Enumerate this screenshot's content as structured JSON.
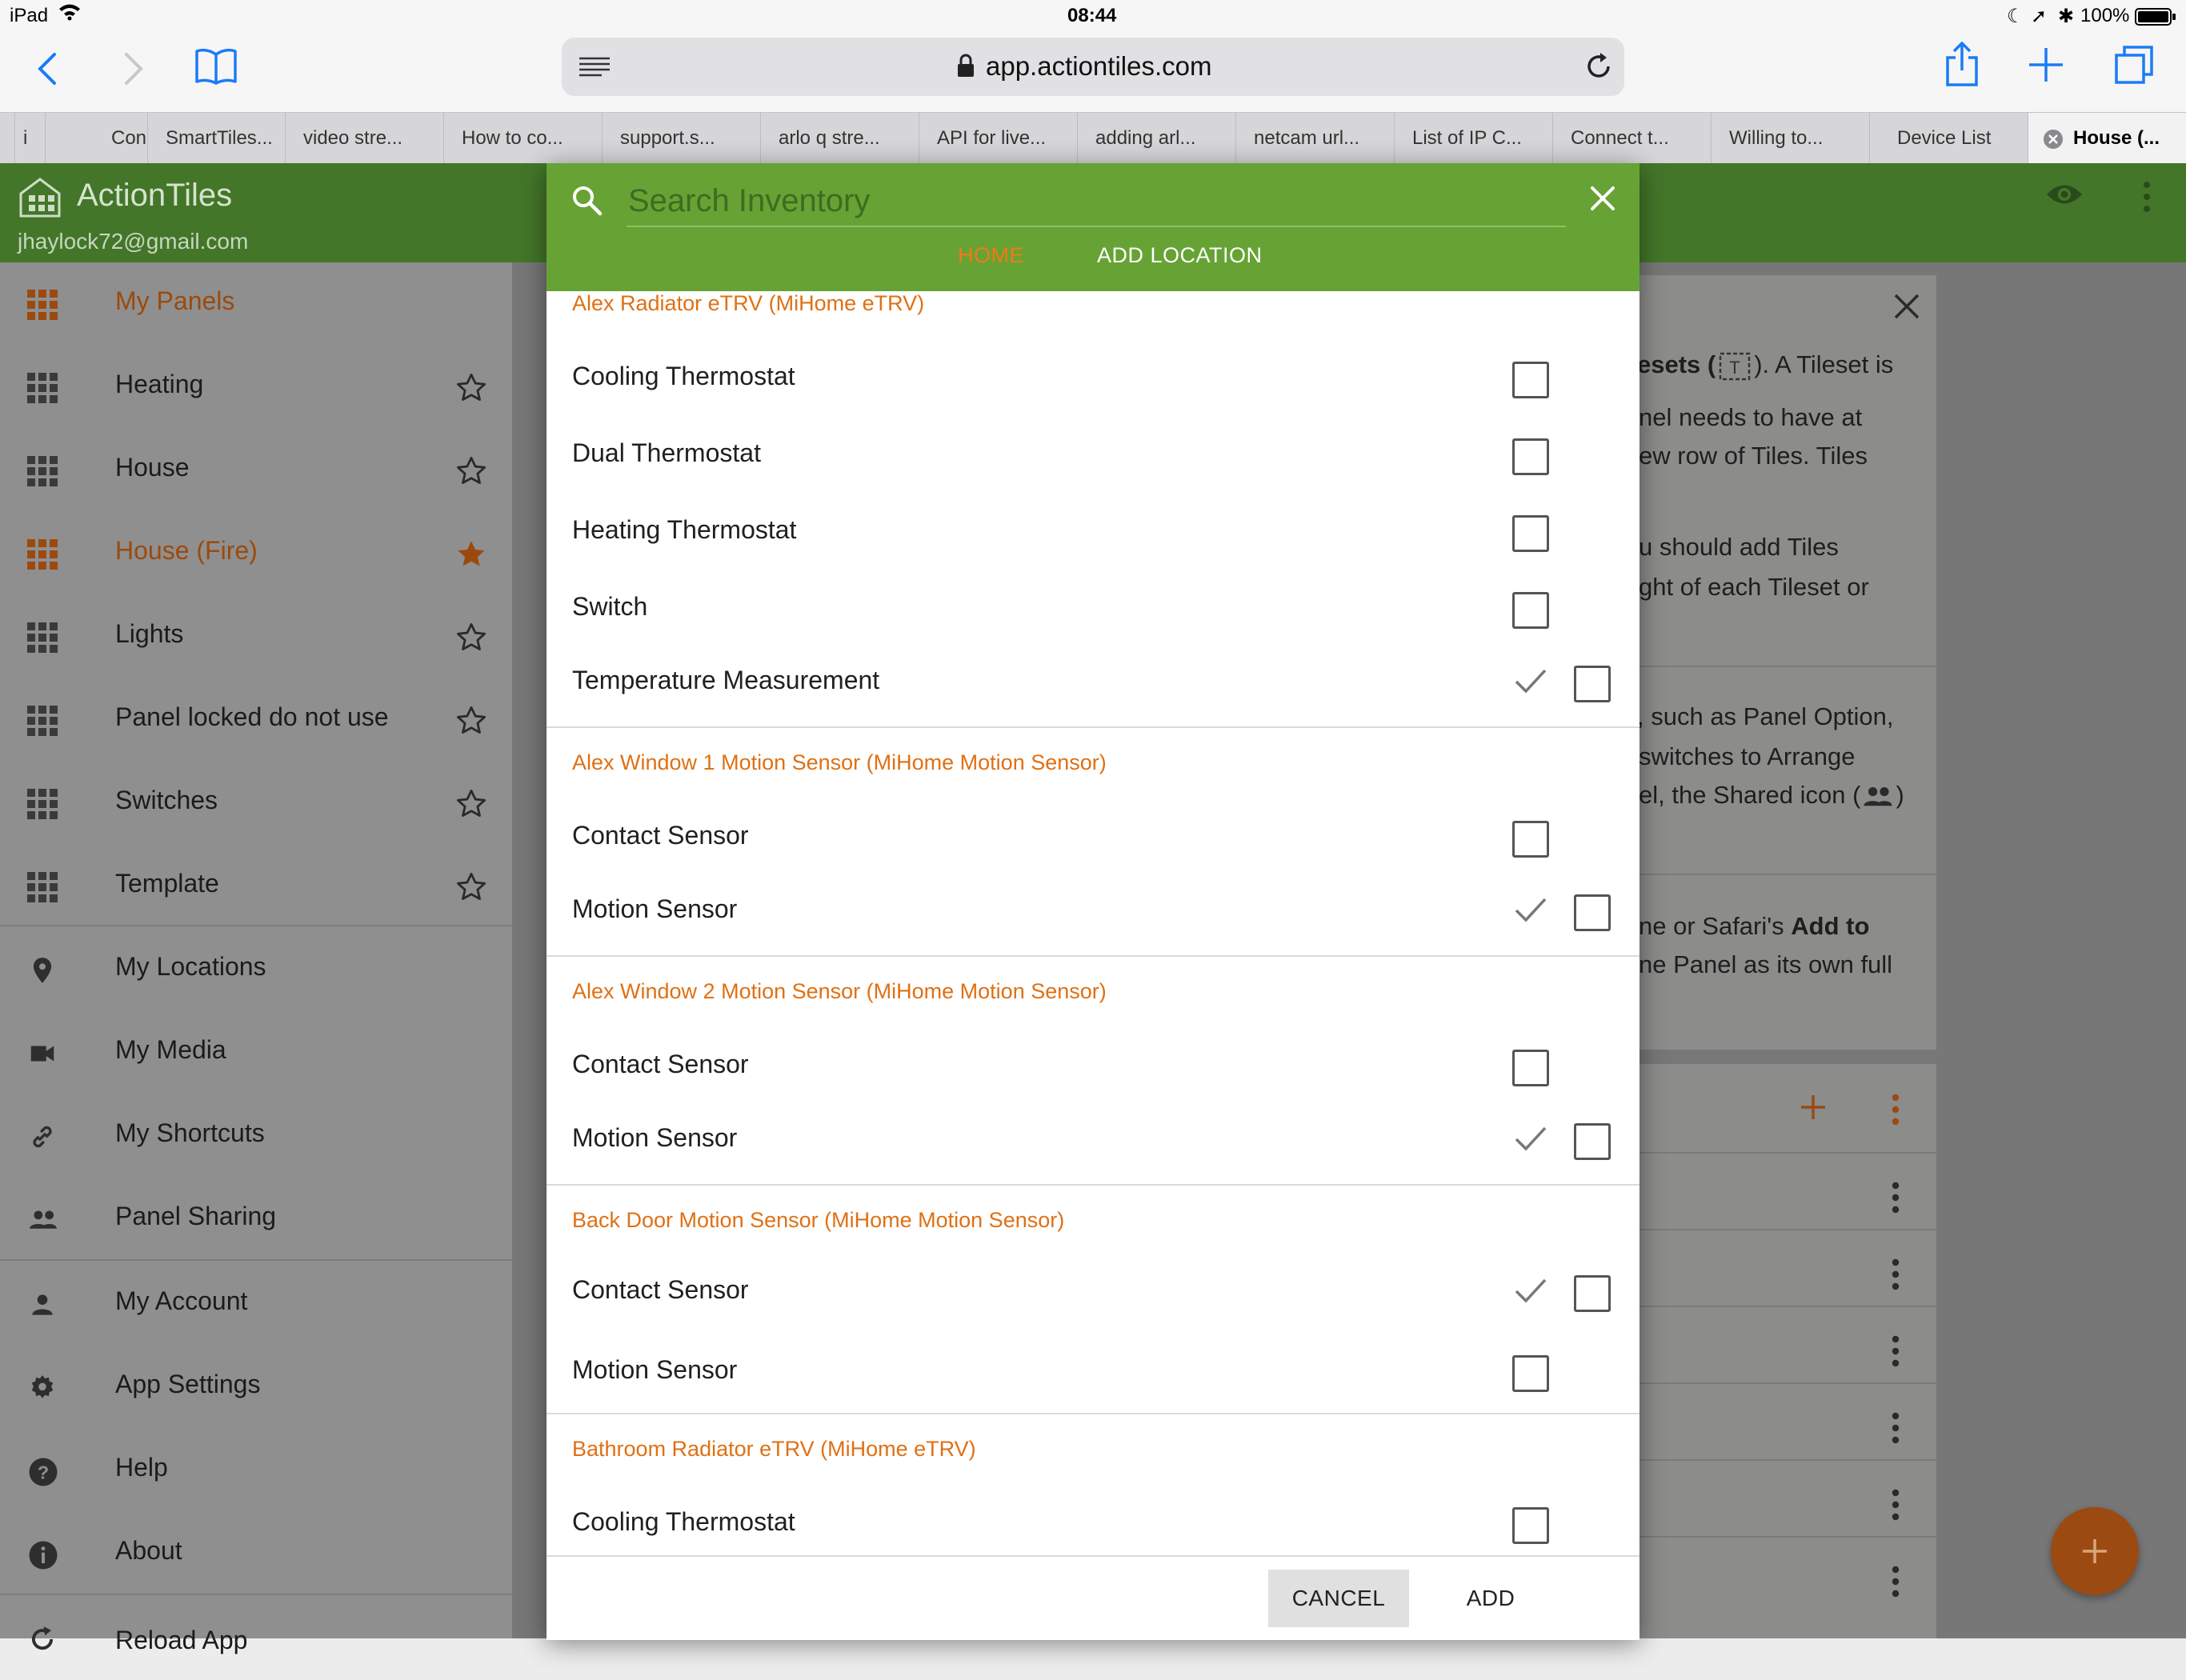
{
  "status_bar": {
    "device": "iPad",
    "time": "08:44",
    "battery": "100%"
  },
  "browser": {
    "url": "app.actiontiles.com",
    "tabs": [
      {
        "label": "i"
      },
      {
        "label": "Con"
      },
      {
        "label": "SmartTiles..."
      },
      {
        "label": "video stre..."
      },
      {
        "label": "How to co..."
      },
      {
        "label": "support.s..."
      },
      {
        "label": "arlo q stre..."
      },
      {
        "label": "API for live..."
      },
      {
        "label": "adding arl..."
      },
      {
        "label": "netcam url..."
      },
      {
        "label": "List of IP C..."
      },
      {
        "label": "Connect t..."
      },
      {
        "label": "Willing to..."
      },
      {
        "label": "Device List"
      },
      {
        "label": "House (..."
      }
    ]
  },
  "app": {
    "title": "ActionTiles",
    "email": "jhaylock72@gmail.com"
  },
  "sidebar": {
    "panels_header": "My Panels",
    "panels": [
      {
        "label": "Heating",
        "starred": false
      },
      {
        "label": "House",
        "starred": false
      },
      {
        "label": "House (Fire)",
        "starred": true,
        "active": true
      },
      {
        "label": "Lights",
        "starred": false
      },
      {
        "label": "Panel locked do not use",
        "starred": false
      },
      {
        "label": "Switches",
        "starred": false
      },
      {
        "label": "Template",
        "starred": false
      }
    ],
    "section2": [
      {
        "label": "My Locations",
        "icon": "location-pin-icon"
      },
      {
        "label": "My Media",
        "icon": "video-camera-icon"
      },
      {
        "label": "My Shortcuts",
        "icon": "link-icon"
      },
      {
        "label": "Panel Sharing",
        "icon": "people-icon"
      }
    ],
    "section3": [
      {
        "label": "My Account",
        "icon": "person-icon"
      },
      {
        "label": "App Settings",
        "icon": "gear-icon"
      },
      {
        "label": "Help",
        "icon": "help-icon"
      },
      {
        "label": "About",
        "icon": "info-icon"
      },
      {
        "label": "Reload App",
        "icon": "reload-icon"
      }
    ]
  },
  "background_text": {
    "line1a": "esets (",
    "line1b": "). A Tileset is",
    "line2": "nel needs to have at",
    "line3": "ew row of Tiles. Tiles",
    "line4": "u should add Tiles",
    "line5": "ght of each Tileset or",
    "line6": ", such as Panel Option,",
    "line7": "switches to Arrange",
    "line8a": "el, the Shared icon (",
    "line8b": ")",
    "line9a": "ne or Safari's ",
    "line9b": "Add to",
    "line10": "ne Panel as its own full"
  },
  "dialog": {
    "search_placeholder": "Search Inventory",
    "tabs": [
      {
        "label": "HOME",
        "active": true
      },
      {
        "label": "ADD LOCATION",
        "active": false
      }
    ],
    "devices": [
      {
        "name": "Alex Radiator eTRV (MiHome eTRV)",
        "capabilities": [
          {
            "label": "Cooling Thermostat",
            "used": false,
            "checked": false
          },
          {
            "label": "Dual Thermostat",
            "used": false,
            "checked": false
          },
          {
            "label": "Heating Thermostat",
            "used": false,
            "checked": false
          },
          {
            "label": "Switch",
            "used": false,
            "checked": false
          },
          {
            "label": "Temperature Measurement",
            "used": true,
            "checked": false
          }
        ]
      },
      {
        "name": "Alex Window 1 Motion Sensor (MiHome Motion Sensor)",
        "capabilities": [
          {
            "label": "Contact Sensor",
            "used": false,
            "checked": false
          },
          {
            "label": "Motion Sensor",
            "used": true,
            "checked": false
          }
        ]
      },
      {
        "name": "Alex Window 2 Motion Sensor (MiHome Motion Sensor)",
        "capabilities": [
          {
            "label": "Contact Sensor",
            "used": false,
            "checked": false
          },
          {
            "label": "Motion Sensor",
            "used": true,
            "checked": false
          }
        ]
      },
      {
        "name": "Back Door Motion Sensor (MiHome Motion Sensor)",
        "capabilities": [
          {
            "label": "Contact Sensor",
            "used": true,
            "checked": false
          },
          {
            "label": "Motion Sensor",
            "used": false,
            "checked": false
          }
        ]
      },
      {
        "name": "Bathroom Radiator eTRV (MiHome eTRV)",
        "capabilities": [
          {
            "label": "Cooling Thermostat",
            "used": false,
            "checked": false
          }
        ]
      }
    ],
    "cancel_label": "CANCEL",
    "add_label": "ADD"
  },
  "colors": {
    "app_green": "#437629",
    "dialog_green": "#66a334",
    "accent_orange": "#e07014",
    "fab": "#9b4a12"
  }
}
